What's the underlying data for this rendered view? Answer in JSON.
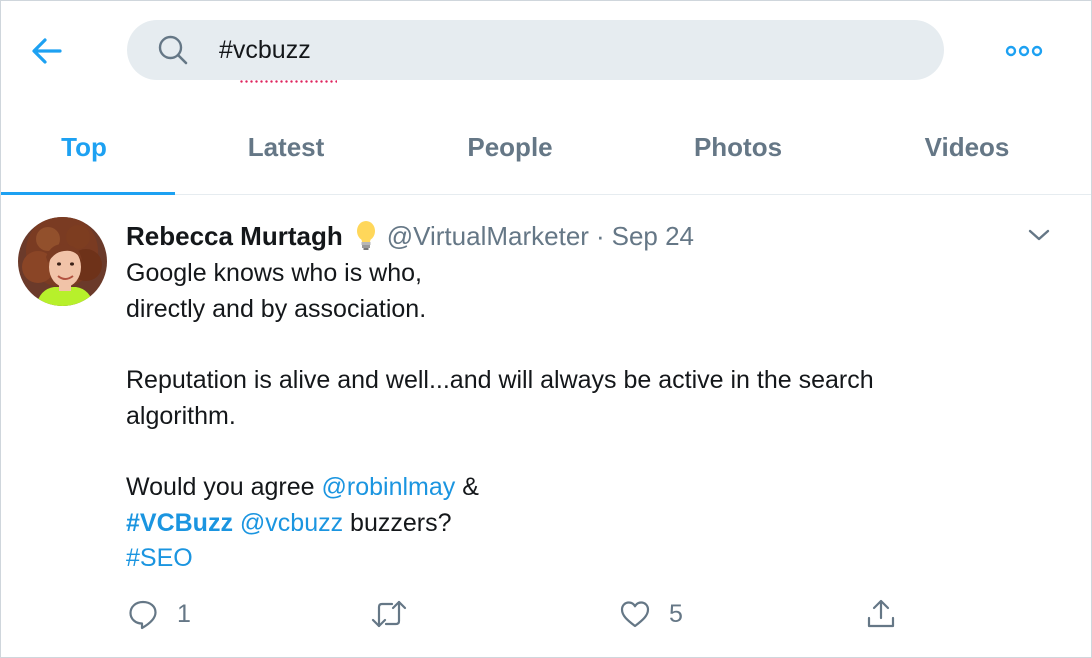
{
  "search": {
    "query": "#vcbuzz"
  },
  "tabs": [
    {
      "label": "Top",
      "active": true
    },
    {
      "label": "Latest",
      "active": false
    },
    {
      "label": "People",
      "active": false
    },
    {
      "label": "Photos",
      "active": false
    },
    {
      "label": "Videos",
      "active": false
    }
  ],
  "tweet": {
    "display_name": "Rebecca Murtagh",
    "name_emoji": "lightbulb-icon",
    "handle": "@VirtualMarketer",
    "separator": "·",
    "date": "Sep 24",
    "text": {
      "line1": "Google knows who is who,",
      "line2": "directly and by association.",
      "line3": "Reputation is alive and well...and will always be active in the search",
      "line4": "algorithm.",
      "line5_pre": "Would you agree ",
      "mention1": "@robinlmay",
      "line5_post": " &",
      "hashtag1": "#VCBuzz",
      "line6_space": " ",
      "mention2": "@vcbuzz",
      "line6_post": " buzzers?",
      "hashtag2": "#SEO"
    },
    "actions": {
      "reply_count": "1",
      "retweet_count": "",
      "like_count": "5"
    }
  },
  "colors": {
    "accent": "#1da1f2",
    "link": "#1b95e0",
    "secondary_text": "#657786",
    "search_bg": "#e6ecf0"
  }
}
